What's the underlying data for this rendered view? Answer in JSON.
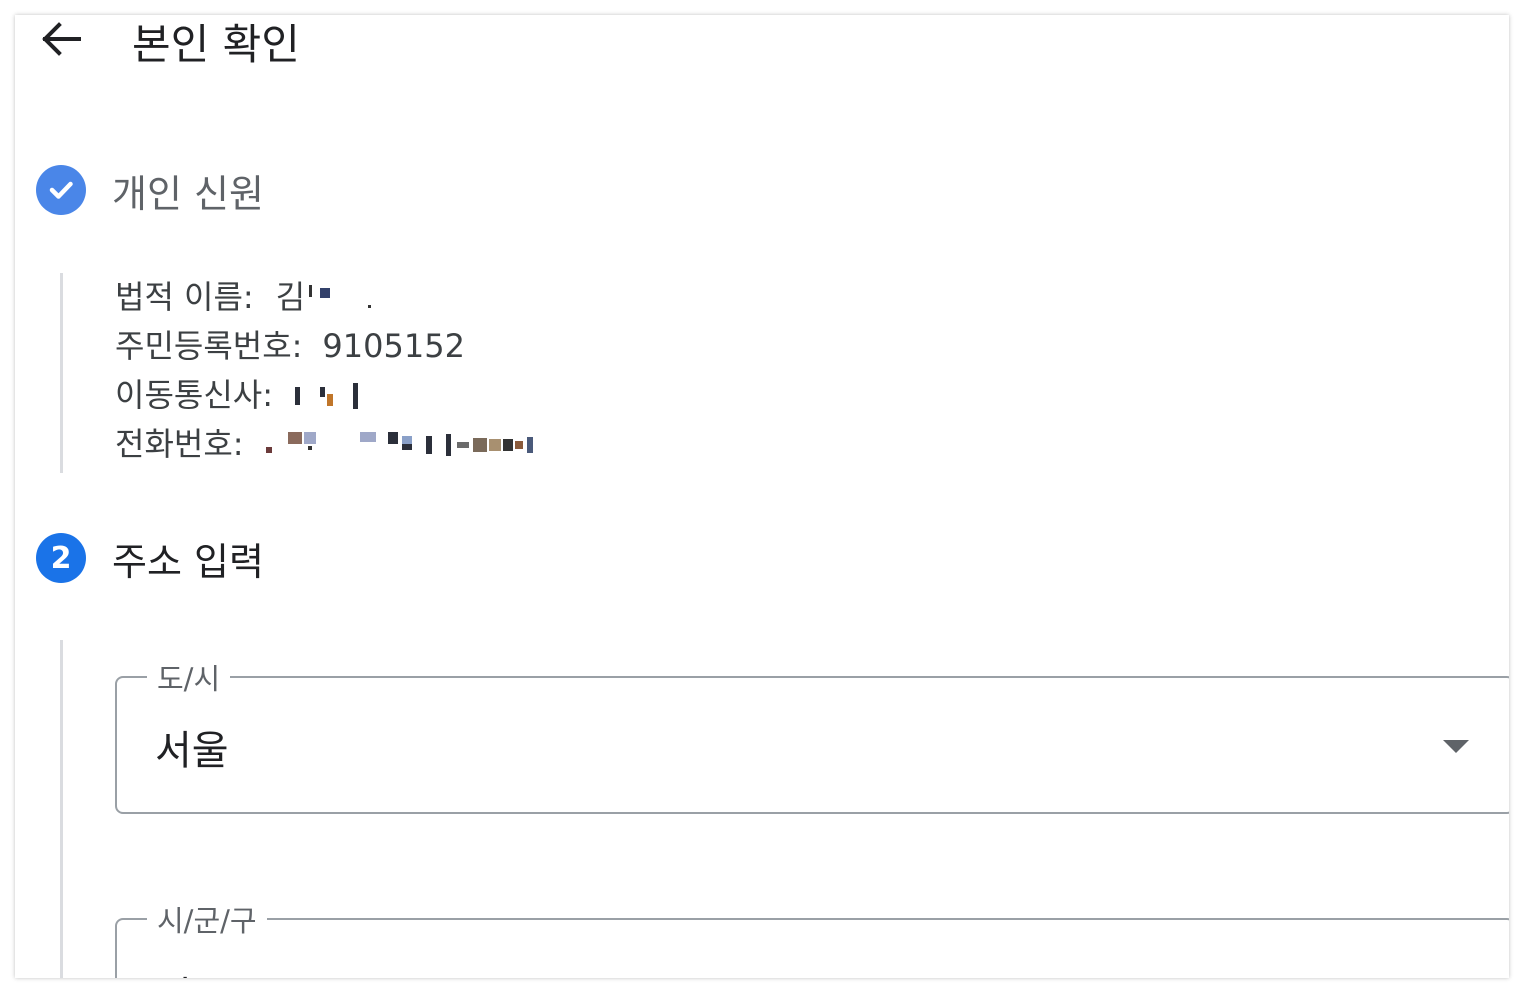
{
  "header": {
    "back_icon": "arrow-left-icon",
    "title": "본인 확인"
  },
  "steps": [
    {
      "status": "complete",
      "badge_icon": "check-icon",
      "title": "개인 신원",
      "details": [
        {
          "label": "법적 이름:",
          "value": "김"
        },
        {
          "label": "주민등록번호:",
          "value": "9105152"
        },
        {
          "label": "이동통신사:",
          "value": ""
        },
        {
          "label": "전화번호:",
          "value": ""
        }
      ]
    },
    {
      "status": "active",
      "number": "2",
      "title": "주소 입력",
      "fields": [
        {
          "label": "도/시",
          "value": "서울",
          "control": "select",
          "arrow_icon": "dropdown-arrow-icon"
        },
        {
          "label": "시/군/구",
          "value": "서도구",
          "control": "select"
        }
      ]
    }
  ],
  "colors": {
    "accent": "#1a73e8",
    "complete": "#4a86e8",
    "border": "#9aa0a6",
    "text_primary": "#202124",
    "text_secondary": "#5f6368"
  }
}
